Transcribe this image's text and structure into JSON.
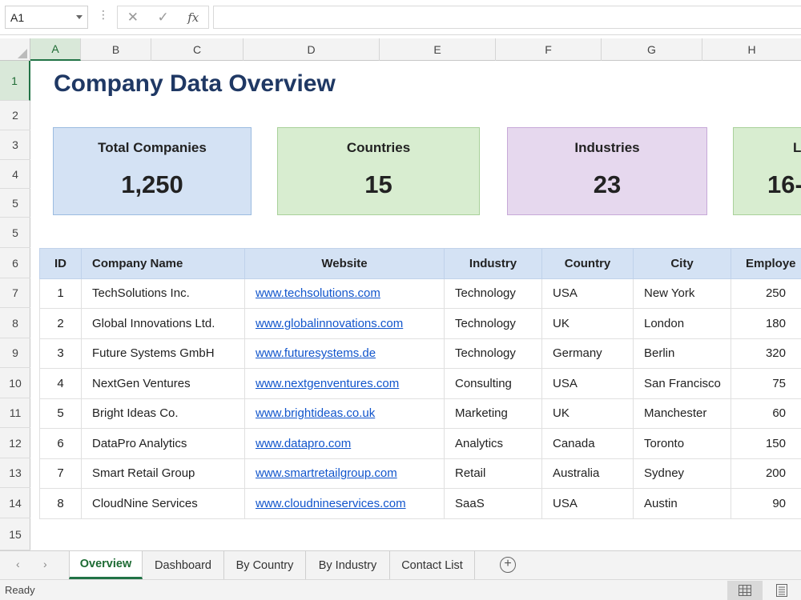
{
  "formula_bar": {
    "name_box": "A1",
    "more": "⋮",
    "cancel_icon": "✕",
    "enter_icon": "✓",
    "fx_label": "fx",
    "formula": ""
  },
  "columns": [
    "A",
    "B",
    "C",
    "D",
    "E",
    "F",
    "G",
    "H"
  ],
  "rows": [
    "1",
    "2",
    "3",
    "4",
    "5",
    "5",
    "6",
    "7",
    "8",
    "9",
    "10",
    "11",
    "12",
    "13",
    "14",
    "15"
  ],
  "title": "Company Data Overview",
  "kpis": [
    {
      "label": "Total Companies",
      "value": "1,250"
    },
    {
      "label": "Countries",
      "value": "15"
    },
    {
      "label": "Industries",
      "value": "23"
    },
    {
      "label": "L",
      "value": "16-"
    }
  ],
  "table": {
    "headers": [
      "ID",
      "Company Name",
      "Website",
      "Industry",
      "Country",
      "City",
      "Employe"
    ],
    "rows": [
      [
        "1",
        "TechSolutions Inc.",
        "www.techsolutions.com",
        "Technology",
        "USA",
        "New York",
        "250"
      ],
      [
        "2",
        "Global Innovations Ltd.",
        "www.globalinnovations.com",
        "Technology",
        "UK",
        "London",
        "180"
      ],
      [
        "3",
        "Future Systems GmbH",
        "www.futuresystems.de",
        "Technology",
        "Germany",
        "Berlin",
        "320"
      ],
      [
        "4",
        "NextGen Ventures",
        "www.nextgenventures.com",
        "Consulting",
        "USA",
        "San Francisco",
        "75"
      ],
      [
        "5",
        "Bright Ideas Co.",
        "www.brightideas.co.uk",
        "Marketing",
        "UK",
        "Manchester",
        "60"
      ],
      [
        "6",
        "DataPro Analytics",
        "www.datapro.com",
        "Analytics",
        "Canada",
        "Toronto",
        "150"
      ],
      [
        "7",
        "Smart Retail Group",
        "www.smartretailgroup.com",
        "Retail",
        "Australia",
        "Sydney",
        "200"
      ],
      [
        "8",
        "CloudNine Services",
        "www.cloudnineservices.com",
        "SaaS",
        "USA",
        "Austin",
        "90"
      ]
    ]
  },
  "tabs": [
    "Overview",
    "Dashboard",
    "By Country",
    "By Industry",
    "Contact List"
  ],
  "active_tab": "Overview",
  "nav": {
    "prev": "‹",
    "next": "›",
    "add": "+"
  },
  "status": "Ready",
  "colors": {
    "accent": "#217346",
    "title": "#1f3864",
    "header_fill": "#d4e2f4",
    "kpi_blue": "#d4e2f4",
    "kpi_green": "#d8edd0",
    "kpi_purple": "#e6d8ee",
    "link": "#1155cc"
  }
}
